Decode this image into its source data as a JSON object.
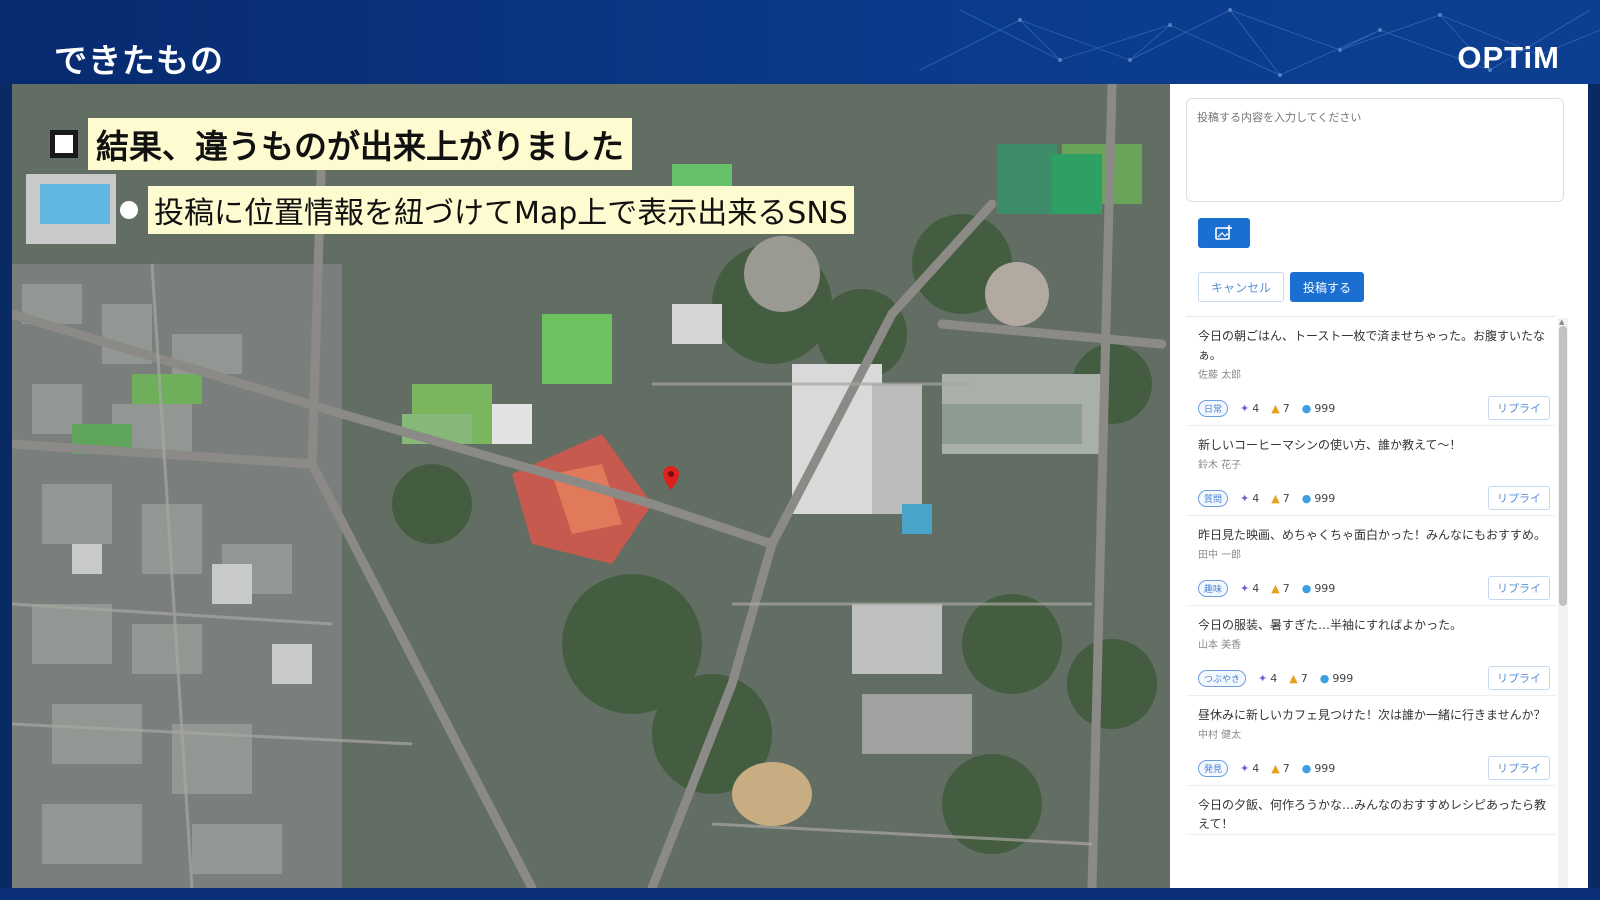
{
  "slide": {
    "title": "できたもの",
    "brand": "OPTiM"
  },
  "callouts": {
    "main": "結果、違うものが出来上がりました",
    "sub": "投稿に位置情報を紐づけてMap上で表示出来るSNS"
  },
  "composer": {
    "placeholder": "投稿する内容を入力してください",
    "image_icon": "image-add-icon",
    "cancel_label": "キャンセル",
    "submit_label": "投稿する"
  },
  "feed": {
    "reply_label": "リプライ",
    "posts": [
      {
        "body": "今日の朝ごはん、トースト一枚で済ませちゃった。お腹すいたなぁ。",
        "author": "佐藤 太郎",
        "tag": "日常",
        "party": "4",
        "likes": "7",
        "comments": "999"
      },
      {
        "body": "新しいコーヒーマシンの使い方、誰か教えて〜！",
        "author": "鈴木 花子",
        "tag": "質問",
        "party": "4",
        "likes": "7",
        "comments": "999"
      },
      {
        "body": "昨日見た映画、めちゃくちゃ面白かった！みんなにもおすすめ。",
        "author": "田中 一郎",
        "tag": "趣味",
        "party": "4",
        "likes": "7",
        "comments": "999"
      },
      {
        "body": "今日の服装、暑すぎた…半袖にすればよかった。",
        "author": "山本 美香",
        "tag": "つぶやき",
        "party": "4",
        "likes": "7",
        "comments": "999"
      },
      {
        "body": "昼休みに新しいカフェ見つけた！次は誰か一緒に行きませんか？",
        "author": "中村 健太",
        "tag": "発見",
        "party": "4",
        "likes": "7",
        "comments": "999"
      },
      {
        "body": "今日の夕飯、何作ろうかな…みんなのおすすめレシピあったら教えて！",
        "author": "",
        "tag": "",
        "party": "",
        "likes": "",
        "comments": ""
      }
    ]
  },
  "colors": {
    "header_bg": "#082a6e",
    "primary": "#1a6fd1",
    "highlight_bg": "#fffbd0",
    "pin": "#e0201c"
  },
  "icons": {
    "pin": "map-pin-icon",
    "party": "party-popper-icon",
    "like": "thumbs-up-icon",
    "comment": "chat-bubble-icon"
  }
}
